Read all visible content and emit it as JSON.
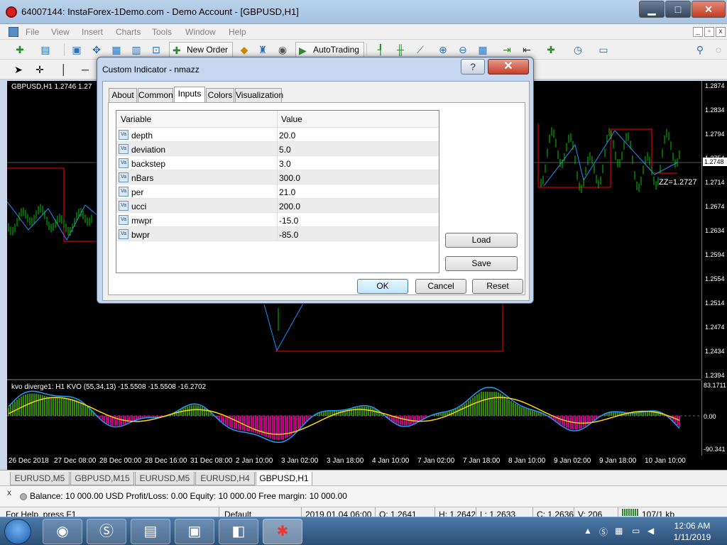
{
  "window": {
    "title": "64007144: InstaForex-1Demo.com - Demo Account - [GBPUSD,H1]",
    "minimize": "▁",
    "maximize": "□",
    "close": "✕"
  },
  "menu": [
    "File",
    "View",
    "Insert",
    "Charts",
    "Tools",
    "Window",
    "Help"
  ],
  "toolbar": {
    "new_order": "New Order",
    "autotrading": "AutoTrading"
  },
  "chart": {
    "symbol_label": "GBPUSD,H1  1.2746 1.27",
    "zz_label": "ZZ=1.2727",
    "current_price": "1.2748",
    "price_ticks": [
      "1.2874",
      "1.2834",
      "1.2794",
      "1.2754",
      "1.2714",
      "1.2674",
      "1.2634",
      "1.2594",
      "1.2554",
      "1.2514",
      "1.2474",
      "1.2434",
      "1.2394"
    ],
    "indicator_label": "kvo diverge1: H1  KVO (55,34,13) -15.5508 -15.5508 -16.2702",
    "indicator_ticks": [
      "83.1711",
      "0.00",
      "-90.341"
    ],
    "time_ticks": [
      "26 Dec 2018",
      "27 Dec 08:00",
      "28 Dec 00:00",
      "28 Dec 16:00",
      "31 Dec 08:00",
      "2 Jan 10:00",
      "3 Jan 02:00",
      "3 Jan 18:00",
      "4 Jan 10:00",
      "7 Jan 02:00",
      "7 Jan 18:00",
      "8 Jan 10:00",
      "9 Jan 02:00",
      "9 Jan 18:00",
      "10 Jan 10:00"
    ],
    "colors": {
      "bull": "#00c800",
      "zigzag_blue": "#1e90ff",
      "channel_red": "#ff0000",
      "hist_pos": "#3cb000",
      "hist_neg": "#ff00aa",
      "line_yellow": "#ffd700",
      "line_blue": "#1aa0ff"
    }
  },
  "symbol_tabs": [
    {
      "label": "EURUSD,M5",
      "active": false
    },
    {
      "label": "GBPUSD,M15",
      "active": false
    },
    {
      "label": "EURUSD,M5",
      "active": false
    },
    {
      "label": "EURUSD,H4",
      "active": false
    },
    {
      "label": "GBPUSD,H1",
      "active": true
    }
  ],
  "terminal": {
    "close": "x",
    "summary": "Balance: 10 000.00 USD  Profit/Loss: 0.00  Equity: 10 000.00  Free margin: 10 000.00"
  },
  "status": {
    "help": "For Help, press F1",
    "profile": "Default",
    "datetime": "2019.01.04 06:00",
    "open": "O: 1.2641",
    "high": "H: 1.2642",
    "low": "L: 1.2633",
    "close": "C: 1.2636",
    "volume": "V: 206",
    "traffic": "107/1 kb"
  },
  "taskbar": {
    "time": "12:06 AM",
    "date": "1/11/2019"
  },
  "dialog": {
    "title": "Custom Indicator - nmazz",
    "help": "?",
    "close": "✕",
    "tabs": [
      {
        "label": "About",
        "active": false
      },
      {
        "label": "Common",
        "active": false
      },
      {
        "label": "Inputs",
        "active": true
      },
      {
        "label": "Colors",
        "active": false
      },
      {
        "label": "Visualization",
        "active": false
      }
    ],
    "grid_headers": {
      "variable": "Variable",
      "value": "Value"
    },
    "inputs": [
      {
        "name": "depth",
        "value": "20.0"
      },
      {
        "name": "deviation",
        "value": "5.0"
      },
      {
        "name": "backstep",
        "value": "3.0"
      },
      {
        "name": "nBars",
        "value": "300.0"
      },
      {
        "name": "per",
        "value": "21.0"
      },
      {
        "name": "ucci",
        "value": "200.0"
      },
      {
        "name": "mwpr",
        "value": "-15.0"
      },
      {
        "name": "bwpr",
        "value": "-85.0"
      }
    ],
    "type_badge": "Va",
    "load": "Load",
    "save": "Save",
    "ok": "OK",
    "cancel": "Cancel",
    "reset": "Reset"
  }
}
